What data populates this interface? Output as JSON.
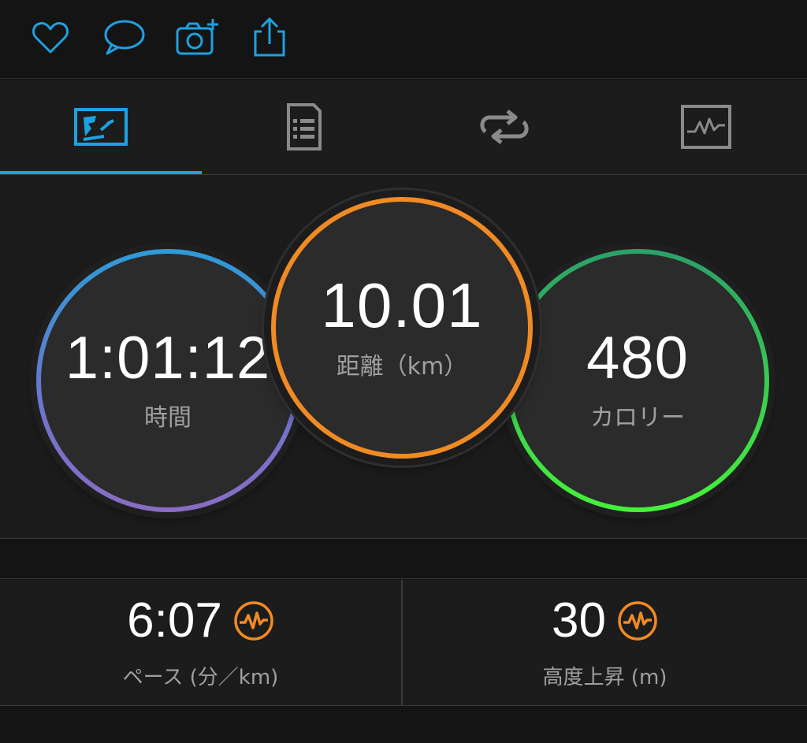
{
  "action_bar": {
    "icons": [
      "heart-icon",
      "comment-icon",
      "add-photo-icon",
      "share-icon"
    ],
    "accent_color": "#1ea1e0"
  },
  "tabs": {
    "items": [
      "overview-icon",
      "details-icon",
      "laps-icon",
      "charts-icon"
    ],
    "selected_index": 0
  },
  "summary": {
    "time": {
      "value": "1:01:12",
      "label": "時間"
    },
    "distance": {
      "value": "10.01",
      "label": "距離（km）"
    },
    "calories": {
      "value": "480",
      "label": "カロリー"
    }
  },
  "stats": {
    "pace": {
      "value": "6:07",
      "label": "ペース (分／km)"
    },
    "elevation": {
      "value": "30",
      "label": "高度上昇 (m)"
    }
  },
  "colors": {
    "time_ring": "#2d9bd8",
    "distance_ring": "#f08a24",
    "calories_ring": "#3bd24c",
    "heart_rate_badge": "#f08a24"
  }
}
